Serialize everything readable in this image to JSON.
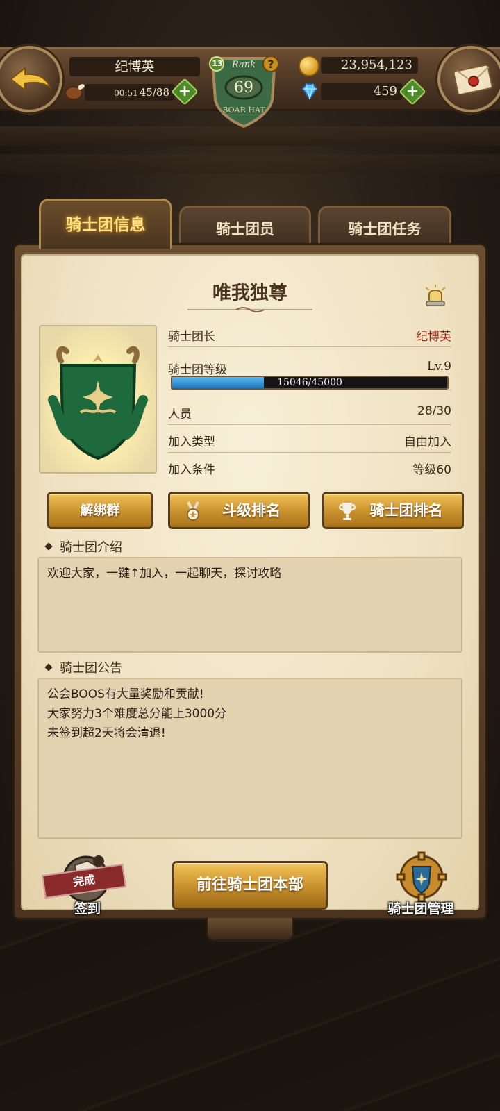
{
  "hud": {
    "player_name": "纪博英",
    "stamina_time": "00:51",
    "stamina_value": "45/88",
    "rank_label": "Rank",
    "rank_value": "69",
    "rank_small": "13",
    "rank_subtitle": "BOAR HAT",
    "gold": "23,954,123",
    "gems": "459"
  },
  "tabs": [
    {
      "label": "骑士团信息",
      "active": true
    },
    {
      "label": "骑士团员",
      "active": false
    },
    {
      "label": "骑士团任务",
      "active": false
    }
  ],
  "guild": {
    "name": "唯我独尊",
    "rows": {
      "leader": {
        "label": "骑士团长",
        "value": "纪博英"
      },
      "level": {
        "label": "骑士团等级",
        "value": "Lv.9",
        "xp_text": "15046/45000",
        "xp_fraction": 0.334
      },
      "members": {
        "label": "人员",
        "value": "28/30"
      },
      "join_type": {
        "label": "加入类型",
        "value": "自由加入"
      },
      "join_cond": {
        "label": "加入条件",
        "value": "等级60"
      }
    }
  },
  "buttons": {
    "unbind": "解绑群",
    "duel_rank": "斗级排名",
    "guild_rank": "骑士团排名",
    "go_hq": "前往骑士团本部"
  },
  "intro": {
    "title": "骑士团介绍",
    "text": "欢迎大家，一键↑加入，一起聊天，探讨攻略"
  },
  "notice": {
    "title": "骑士团公告",
    "lines": [
      "公会BOOS有大量奖励和贡献!",
      "大家努力3个难度总分能上3000分",
      "未签到超2天将会清退!"
    ]
  },
  "checkin": {
    "stamp": "完成",
    "label": "签到"
  },
  "manage": {
    "label": "骑士团管理"
  },
  "colors": {
    "accent_gold": "#d8a030",
    "leader_red": "#9a2a1a",
    "xp_blue": "#2a88d0"
  }
}
